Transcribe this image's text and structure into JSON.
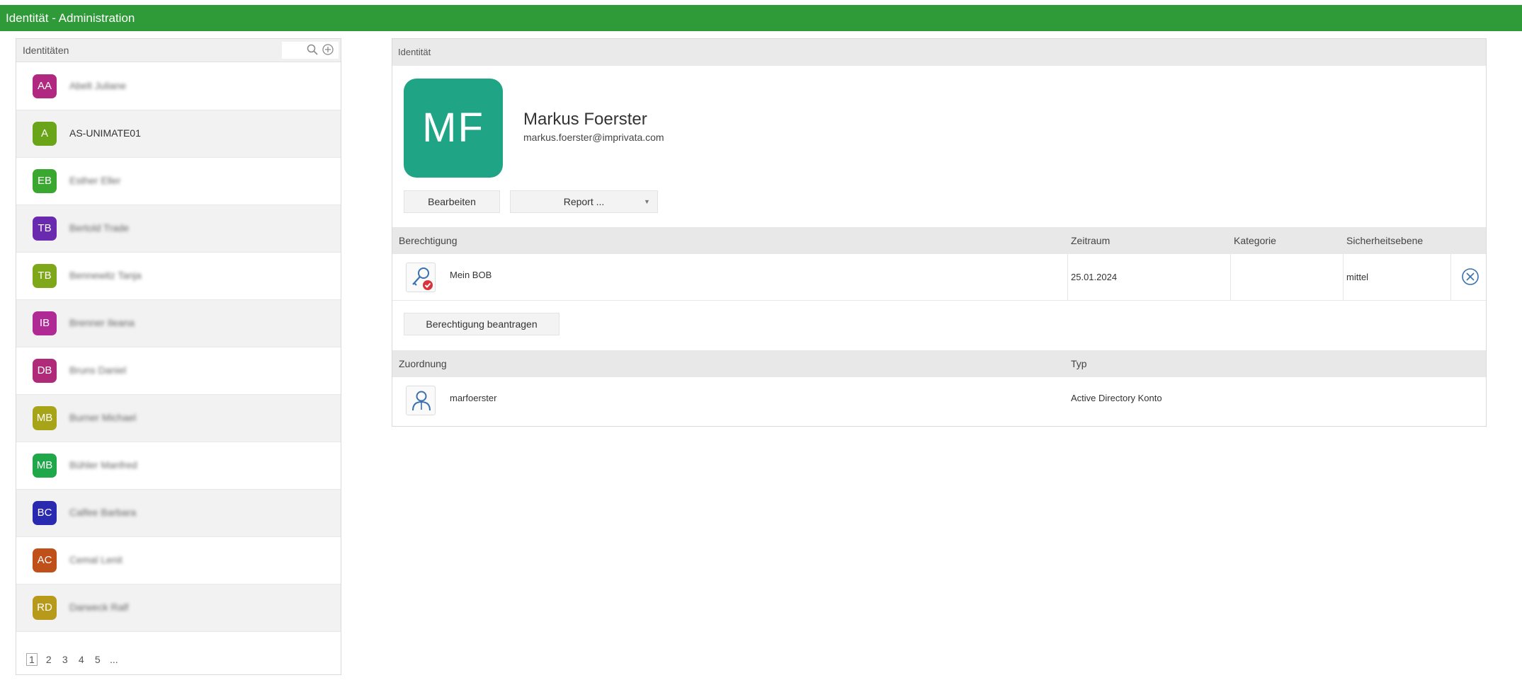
{
  "window": {
    "title": "Identität - Administration"
  },
  "sidebar": {
    "header": "Identitäten",
    "search_icon": "search-icon",
    "add_icon": "add-circle-icon",
    "items": [
      {
        "initials": "AA",
        "name": "Abelt Juliane",
        "color": "#b0287f",
        "blurred": true
      },
      {
        "initials": "A",
        "name": "AS-UNIMATE01",
        "color": "#6aa519",
        "blurred": false
      },
      {
        "initials": "EB",
        "name": "Esther Eller",
        "color": "#3aa830",
        "blurred": true
      },
      {
        "initials": "TB",
        "name": "Bertold Trade",
        "color": "#6a2ab0",
        "blurred": true
      },
      {
        "initials": "TB",
        "name": "Bennewitz Tanja",
        "color": "#7ea81a",
        "blurred": true
      },
      {
        "initials": "IB",
        "name": "Brenner Ileana",
        "color": "#b02a96",
        "blurred": true
      },
      {
        "initials": "DB",
        "name": "Bruns Daniel",
        "color": "#b02a7a",
        "blurred": true
      },
      {
        "initials": "MB",
        "name": "Burner Michael",
        "color": "#a8a418",
        "blurred": true
      },
      {
        "initials": "MB",
        "name": "Bühler Manfred",
        "color": "#1fa84a",
        "blurred": true
      },
      {
        "initials": "BC",
        "name": "Calfee Barbara",
        "color": "#2a2ab0",
        "blurred": true
      },
      {
        "initials": "AC",
        "name": "Cemal Lenit",
        "color": "#c0501a",
        "blurred": true
      },
      {
        "initials": "RD",
        "name": "Darweck Ralf",
        "color": "#b89a1a",
        "blurred": true
      }
    ],
    "pager": [
      "1",
      "2",
      "3",
      "4",
      "5",
      "..."
    ]
  },
  "identity": {
    "header": "Identität",
    "initials": "MF",
    "name": "Markus Foerster",
    "email": "markus.foerster@imprivata.com",
    "edit_label": "Bearbeiten",
    "report_label": "Report ...",
    "report_arrow": "▼"
  },
  "permissions": {
    "columns": [
      "Berechtigung",
      "Zeitraum",
      "Kategorie",
      "Sicherheitsebene"
    ],
    "rows": [
      {
        "name": "Mein BOB",
        "period": "25.01.2024",
        "category": "",
        "level": "mittel",
        "icon": "key-check-icon"
      }
    ],
    "request_label": "Berechtigung beantragen"
  },
  "assignments": {
    "columns": [
      "Zuordnung",
      "Typ"
    ],
    "rows": [
      {
        "name": "marfoerster",
        "type": "Active Directory Konto",
        "icon": "user-account-icon"
      }
    ]
  }
}
